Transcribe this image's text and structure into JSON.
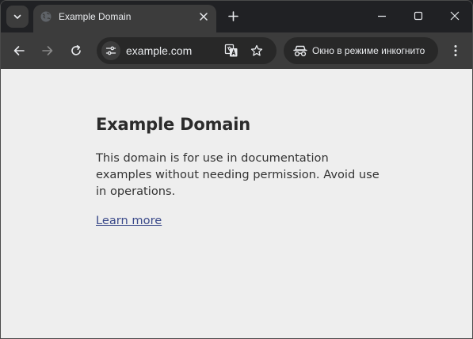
{
  "browser": {
    "tab": {
      "title": "Example Domain"
    },
    "toolbar": {
      "url": "example.com",
      "incognito_label": "Окно в режиме инкогнито"
    },
    "icons": {
      "tab_search": "chevron-down-icon",
      "favicon": "globe-icon",
      "tab_close": "close-icon",
      "new_tab": "plus-icon",
      "minimize": "minimize-icon",
      "maximize": "maximize-icon",
      "close_window": "close-icon",
      "back": "arrow-left-icon",
      "forward": "arrow-right-icon",
      "reload": "reload-icon",
      "site_info": "tune-icon",
      "translate": "translate-icon",
      "bookmark": "star-icon",
      "incognito": "incognito-icon",
      "menu": "more-vertical-icon"
    }
  },
  "page": {
    "title": "Example Domain",
    "description": "This domain is for use in documentation examples without needing permission. Avoid use in operations.",
    "link_text": "Learn more"
  },
  "colors": {
    "tabstrip_bg": "#202124",
    "toolbar_bg": "#3c3c3c",
    "omnibox_bg": "#282828",
    "page_bg": "#eeeeee",
    "link": "#3b4a8a"
  }
}
